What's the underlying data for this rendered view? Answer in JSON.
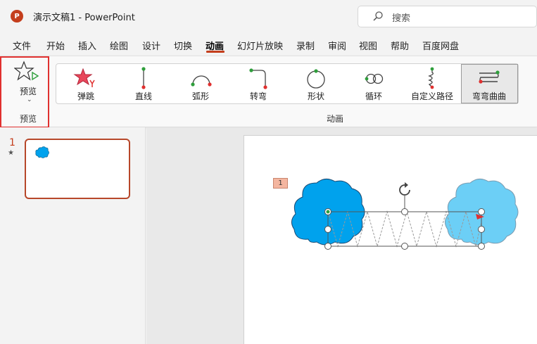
{
  "window": {
    "doc_title": "演示文稿1  -  PowerPoint",
    "app_letter": "P"
  },
  "search": {
    "placeholder": "搜索"
  },
  "menu": {
    "items": [
      "文件",
      "开始",
      "插入",
      "绘图",
      "设计",
      "切换",
      "动画",
      "幻灯片放映",
      "录制",
      "审阅",
      "视图",
      "帮助",
      "百度网盘"
    ],
    "active": "动画"
  },
  "ribbon": {
    "preview": {
      "label": "预览",
      "group_label": "预览"
    },
    "animations": [
      {
        "label": "弹跳",
        "icon": "bounce-icon"
      },
      {
        "label": "直线",
        "icon": "line-path-icon"
      },
      {
        "label": "弧形",
        "icon": "arc-path-icon"
      },
      {
        "label": "转弯",
        "icon": "turn-path-icon"
      },
      {
        "label": "形状",
        "icon": "shape-path-icon"
      },
      {
        "label": "循环",
        "icon": "loop-path-icon"
      },
      {
        "label": "自定义路径",
        "icon": "custom-path-icon"
      },
      {
        "label": "弯弯曲曲",
        "icon": "zigzag-path-icon",
        "selected": true
      }
    ],
    "group_label": "动画"
  },
  "thumbnails": {
    "slide_number": "1",
    "star": "★"
  },
  "slide": {
    "animation_tag": "1"
  },
  "colors": {
    "accent": "#c43e1c",
    "highlight_box": "#e0302f",
    "cloud_start": "#00a2ed",
    "cloud_end": "#6ccff6",
    "path_green": "#2e9e3b",
    "path_red": "#e0302f"
  }
}
